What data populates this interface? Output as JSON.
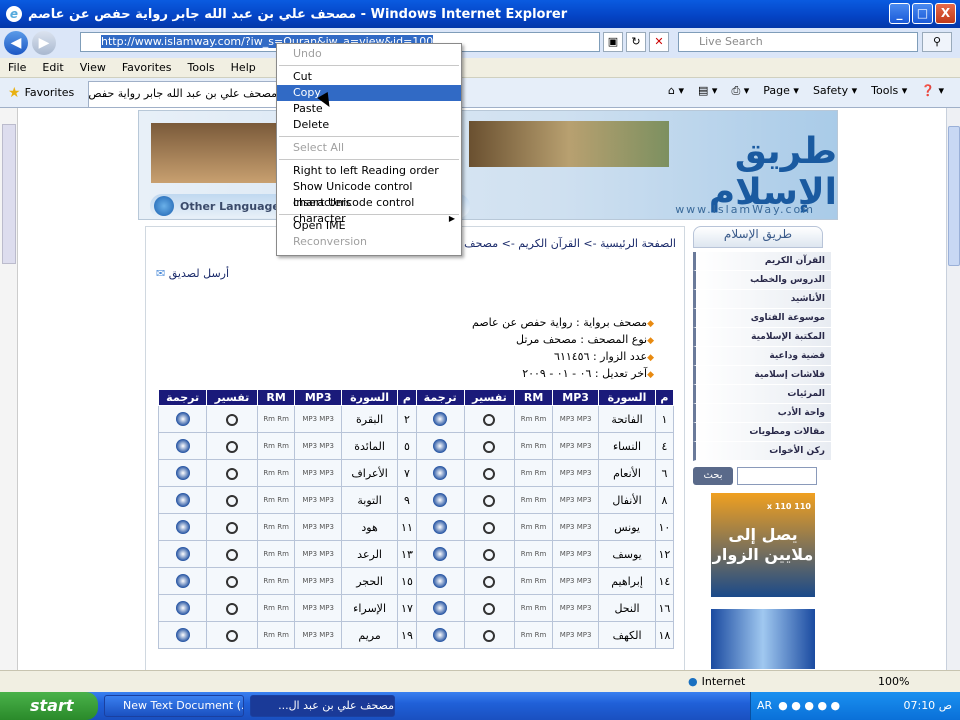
{
  "window": {
    "title": "مصحف علي بن عبد الله جابر رواية حفص عن عاصم - Windows Internet Explorer",
    "buttons": {
      "minimize": "_",
      "maximize": "□",
      "close": "X"
    }
  },
  "address_bar": {
    "url": "http://www.islamway.com/?iw_s=Quran&iw_a=view&id=100",
    "search_placeholder": "Live Search"
  },
  "menu": [
    "File",
    "Edit",
    "View",
    "Favorites",
    "Tools",
    "Help"
  ],
  "tabs": {
    "favorites_label": "Favorites",
    "active_tab": "مصحف علي بن عبد الله جابر رواية حفص عن عاصم",
    "commands": [
      "Page ▾",
      "Safety ▾",
      "Tools ▾"
    ]
  },
  "context_menu": {
    "items": [
      {
        "label": "Undo",
        "state": "disabled"
      },
      {
        "label": "",
        "state": "separator"
      },
      {
        "label": "Cut",
        "state": "normal"
      },
      {
        "label": "Copy",
        "state": "highlighted"
      },
      {
        "label": "Paste",
        "state": "normal"
      },
      {
        "label": "Delete",
        "state": "normal"
      },
      {
        "label": "",
        "state": "separator"
      },
      {
        "label": "Select All",
        "state": "disabled"
      },
      {
        "label": "",
        "state": "separator"
      },
      {
        "label": "Right to left Reading order",
        "state": "normal"
      },
      {
        "label": "Show Unicode control characters",
        "state": "normal"
      },
      {
        "label": "Insert Unicode control character",
        "state": "submenu"
      },
      {
        "label": "",
        "state": "separator"
      },
      {
        "label": "Open IME",
        "state": "normal"
      },
      {
        "label": "Reconversion",
        "state": "disabled"
      }
    ]
  },
  "banner": {
    "logo_text": "طريق الإسلام",
    "site_url": "www.IslamWay.com",
    "lang_button": "Other Languages"
  },
  "breadcrumb": {
    "home": "الصفحة الرئيسية",
    "quran": "القرآن الكريم",
    "current": "مصحف علي بن عبد الله جابر",
    "sep": " -> "
  },
  "send_friend": "أرسل لصديق",
  "info": [
    "مصحف برواية : رواية حفص عن عاصم",
    "نوع المصحف : مصحف مرتل",
    "عدد الزوار : ٦١١٤٥٦",
    "آخر تعديل : ٠٦ - ٠١ - ٢٠٠٩"
  ],
  "table": {
    "headers": [
      "م",
      "السورة",
      "MP3",
      "RM",
      "تفسير",
      "ترجمة",
      "م",
      "السورة",
      "MP3",
      "RM",
      "تفسير",
      "ترجمة"
    ],
    "rows": [
      {
        "n1": "١",
        "s1": "الفاتحة",
        "n2": "٢",
        "s2": "البقرة"
      },
      {
        "n1": "٤",
        "s1": "النساء",
        "n2": "٥",
        "s2": "المائدة"
      },
      {
        "n1": "٦",
        "s1": "الأنعام",
        "n2": "٧",
        "s2": "الأعراف"
      },
      {
        "n1": "٨",
        "s1": "الأنفال",
        "n2": "٩",
        "s2": "التوبة"
      },
      {
        "n1": "١٠",
        "s1": "يونس",
        "n2": "١١",
        "s2": "هود"
      },
      {
        "n1": "١٢",
        "s1": "يوسف",
        "n2": "١٣",
        "s2": "الرعد"
      },
      {
        "n1": "١٤",
        "s1": "إبراهيم",
        "n2": "١٥",
        "s2": "الحجر"
      },
      {
        "n1": "١٦",
        "s1": "النحل",
        "n2": "١٧",
        "s2": "الإسراء"
      },
      {
        "n1": "١٨",
        "s1": "الكهف",
        "n2": "١٩",
        "s2": "مريم"
      }
    ],
    "mp3_label": "MP3 MP3",
    "rm_label": "Rm Rm"
  },
  "sidebar": {
    "header": "طريق الإسلام",
    "items": [
      "القرآن الكريم",
      "الدروس والخطب",
      "الأناشيد",
      "موسوعة الفتاوى",
      "المكتبة الإسلامية",
      "قضية وداعية",
      "فلاشات إسلامية",
      "المرئيات",
      "واحة الأدب",
      "مقالات ومطويات",
      "ركن الأخوات"
    ],
    "search_button": "بحث",
    "ad_size": "110 x 110",
    "ad_text": "يصل إلى ملايين الزوار"
  },
  "status": {
    "zone": "Internet",
    "zoom": "100%"
  },
  "taskbar": {
    "start": "start",
    "items": [
      "New Text Document (...",
      "مصحف علي بن عبد ال..."
    ],
    "lang": "AR",
    "clock": "07:10 ص"
  }
}
